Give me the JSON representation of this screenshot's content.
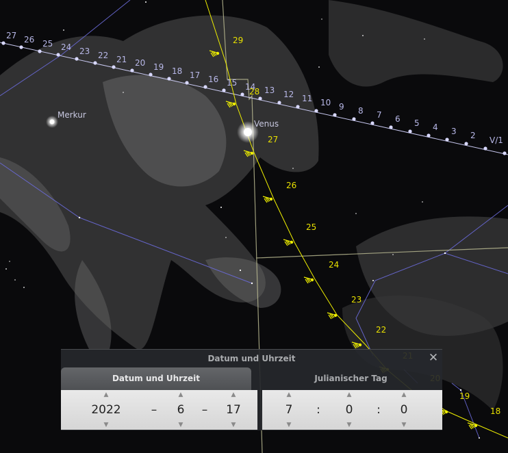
{
  "sky": {
    "ecliptic_numbers_left": [
      "27",
      "26",
      "25",
      "24",
      "23",
      "22",
      "21",
      "20",
      "19",
      "18",
      "17",
      "16",
      "15",
      "14"
    ],
    "ecliptic_numbers_right": [
      "13",
      "12",
      "11",
      "10",
      "9",
      "8",
      "7",
      "6",
      "5",
      "4",
      "3",
      "2",
      "V/1"
    ],
    "venus_path_numbers": [
      "29",
      "28",
      "27",
      "26",
      "25",
      "24",
      "23",
      "22",
      "21",
      "20",
      "19",
      "18"
    ],
    "planet_labels": {
      "mercury": "Merkur",
      "venus": "Venus"
    },
    "colors": {
      "ecliptic": "#c8c8f0",
      "venus_path": "#f0f000",
      "constellation_lines": "#6a6ad8",
      "boundary_lines": "#b8b890"
    }
  },
  "dialog": {
    "title": "Datum und Uhrzeit",
    "close_icon": "close-icon",
    "tabs": [
      "Datum und Uhrzeit",
      "Julianischer Tag"
    ],
    "date": {
      "year": "2022",
      "month": "6",
      "day": "17",
      "separator": "–"
    },
    "time": {
      "hour": "7",
      "minute": "0",
      "second": "0",
      "separator": ":"
    }
  }
}
